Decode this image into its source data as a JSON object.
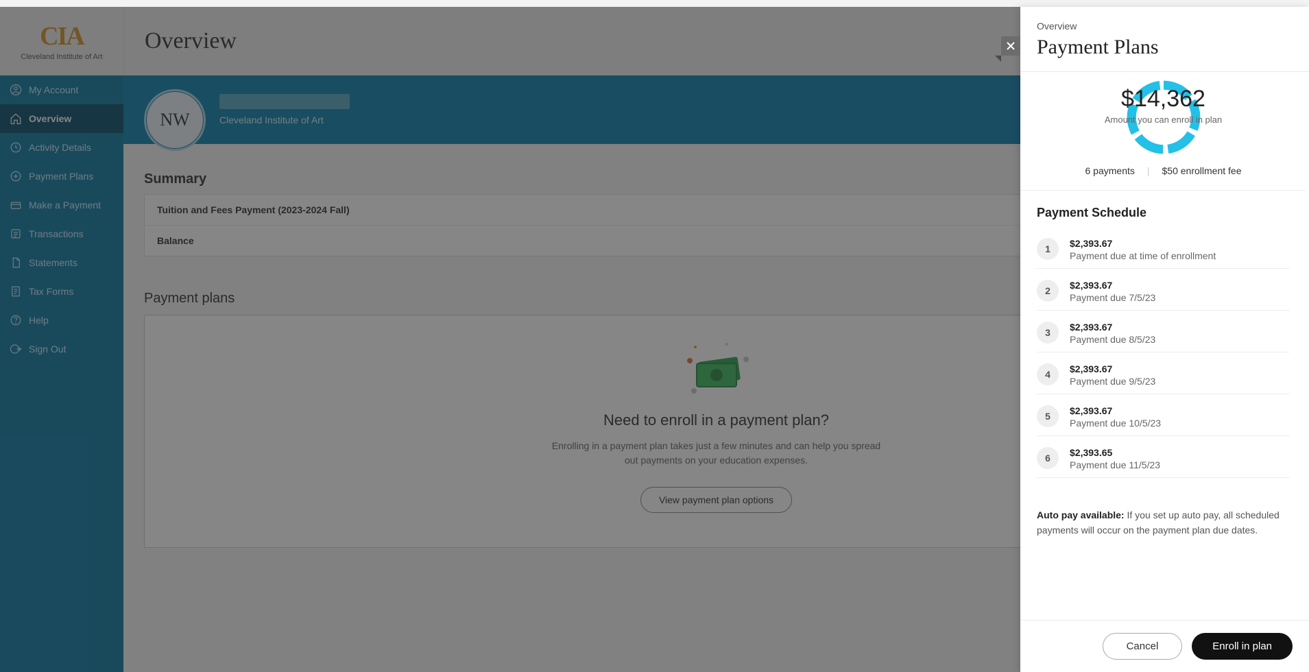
{
  "logo": {
    "text": "CIA",
    "subtitle": "Cleveland Institute of Art"
  },
  "header": {
    "title": "Overview"
  },
  "sidebar": {
    "items": [
      {
        "label": "My Account"
      },
      {
        "label": "Overview"
      },
      {
        "label": "Activity Details"
      },
      {
        "label": "Payment Plans"
      },
      {
        "label": "Make a Payment"
      },
      {
        "label": "Transactions"
      },
      {
        "label": "Statements"
      },
      {
        "label": "Tax Forms"
      },
      {
        "label": "Help"
      },
      {
        "label": "Sign Out"
      }
    ]
  },
  "profile": {
    "initials": "NW",
    "institution": "Cleveland Institute of Art"
  },
  "summary": {
    "heading": "Summary",
    "row1": "Tuition and Fees Payment (2023-2024 Fall)",
    "row2": "Balance"
  },
  "plans": {
    "heading": "Payment plans",
    "headline": "Need to enroll in a payment plan?",
    "sub": "Enrolling in a payment plan takes just a few minutes and can help you spread out payments on your education expenses.",
    "button": "View payment plan options"
  },
  "panel": {
    "crumb": "Overview",
    "title": "Payment Plans",
    "amount": "$14,362",
    "amount_sub": "Amount you can enroll in plan",
    "meta_payments": "6 payments",
    "meta_fee": "$50 enrollment fee",
    "schedule_title": "Payment Schedule",
    "schedule": [
      {
        "n": "1",
        "amount": "$2,393.67",
        "due": "Payment due at time of enrollment"
      },
      {
        "n": "2",
        "amount": "$2,393.67",
        "due": "Payment due 7/5/23"
      },
      {
        "n": "3",
        "amount": "$2,393.67",
        "due": "Payment due 8/5/23"
      },
      {
        "n": "4",
        "amount": "$2,393.67",
        "due": "Payment due 9/5/23"
      },
      {
        "n": "5",
        "amount": "$2,393.67",
        "due": "Payment due 10/5/23"
      },
      {
        "n": "6",
        "amount": "$2,393.65",
        "due": "Payment due 11/5/23"
      }
    ],
    "autopay_label": "Auto pay available:",
    "autopay_text": " If you set up auto pay, all scheduled payments will occur on the payment plan due dates.",
    "cancel": "Cancel",
    "enroll": "Enroll in plan"
  }
}
